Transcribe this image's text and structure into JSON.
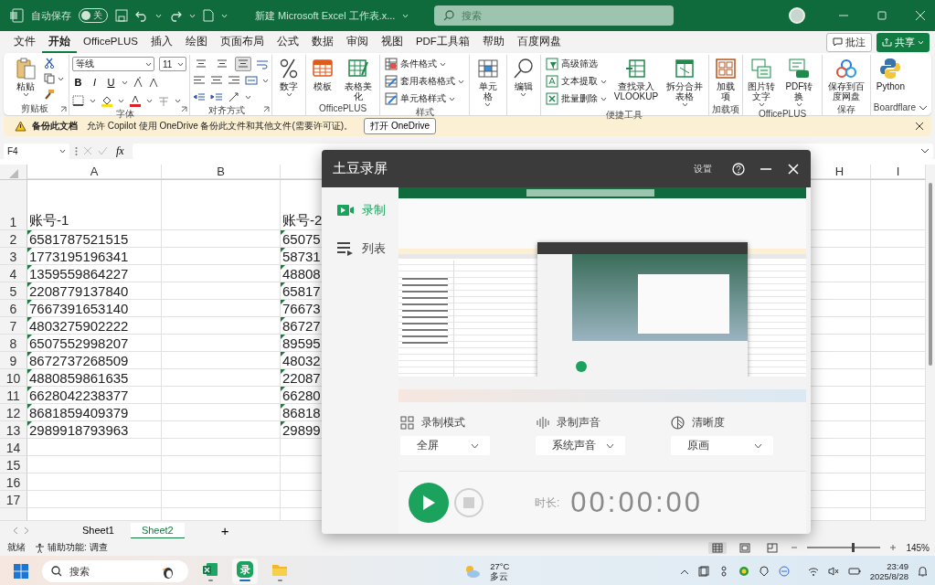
{
  "title_bar": {
    "autosave": {
      "label": "自动保存",
      "on": false,
      "state_text": "关"
    },
    "document_title": "新建 Microsoft Excel 工作表.x...",
    "search": {
      "placeholder": "搜索"
    }
  },
  "menu_tabs": [
    {
      "label": "文件",
      "selected": false
    },
    {
      "label": "开始",
      "selected": true
    },
    {
      "label": "OfficePLUS",
      "selected": false
    },
    {
      "label": "插入",
      "selected": false
    },
    {
      "label": "绘图",
      "selected": false
    },
    {
      "label": "页面布局",
      "selected": false
    },
    {
      "label": "公式",
      "selected": false
    },
    {
      "label": "数据",
      "selected": false
    },
    {
      "label": "审阅",
      "selected": false
    },
    {
      "label": "视图",
      "selected": false
    },
    {
      "label": "PDF工具箱",
      "selected": false
    },
    {
      "label": "帮助",
      "selected": false
    },
    {
      "label": "百度网盘",
      "selected": false
    }
  ],
  "comment_button": "批注",
  "share_button": "共享",
  "ribbon": {
    "groups": [
      {
        "kind": "buttons",
        "label": "剪贴板",
        "launcher": true,
        "items": [
          {
            "kind": "large",
            "label": "粘贴",
            "dropdown": true
          },
          {
            "kind": "small",
            "dropdown": false
          },
          {
            "kind": "small",
            "dropdown": true
          },
          {
            "kind": "small",
            "dropdown": false
          }
        ]
      },
      {
        "kind": "font",
        "label": "字体",
        "launcher": true,
        "font_name": "等线",
        "font_size": "11",
        "styles": [
          "B",
          "I",
          "U"
        ]
      },
      {
        "kind": "align",
        "label": "对齐方式",
        "launcher": true,
        "vertical_align": [
          {
            "selected": false
          },
          {
            "selected": false
          },
          {
            "selected": true
          }
        ]
      },
      {
        "kind": "buttons",
        "launcher": false,
        "items": [
          {
            "kind": "large",
            "label": "数字",
            "dropdown": true
          }
        ]
      },
      {
        "kind": "buttons",
        "label": "OfficePLUS",
        "launcher": false,
        "items": [
          {
            "kind": "large",
            "label": "模板",
            "dropdown": false
          },
          {
            "kind": "large",
            "label": "表格美化",
            "dropdown": false
          }
        ]
      },
      {
        "kind": "buttons",
        "label": "样式",
        "launcher": false,
        "items": [
          {
            "kind": "small",
            "label": "条件格式",
            "dropdown": true
          },
          {
            "kind": "small",
            "label": "套用表格格式",
            "dropdown": true
          },
          {
            "kind": "small",
            "label": "单元格样式",
            "dropdown": true
          }
        ]
      },
      {
        "kind": "buttons",
        "launcher": false,
        "items": [
          {
            "kind": "large",
            "label": "单元格",
            "dropdown": true
          }
        ]
      },
      {
        "kind": "buttons",
        "launcher": false,
        "items": [
          {
            "kind": "large",
            "label": "编辑",
            "dropdown": true
          }
        ]
      },
      {
        "kind": "buttons",
        "label": "便捷工具",
        "launcher": false,
        "items": [
          {
            "kind": "small",
            "label": "高级筛选",
            "dropdown": false
          },
          {
            "kind": "small",
            "label": "文本提取",
            "dropdown": true
          },
          {
            "kind": "small",
            "label": "批量删除",
            "dropdown": true
          },
          {
            "kind": "large",
            "label": "查找录入\nVLOOKUP",
            "dropdown": false
          },
          {
            "kind": "large",
            "label": "拆分合并表格",
            "dropdown": true
          }
        ]
      },
      {
        "kind": "buttons",
        "label": "加载项",
        "launcher": false,
        "items": [
          {
            "kind": "large",
            "label": "加载项",
            "dropdown": false
          }
        ]
      },
      {
        "kind": "buttons",
        "label": "OfficePLUS",
        "launcher": false,
        "items": [
          {
            "kind": "large",
            "label": "图片转文字",
            "dropdown": true
          },
          {
            "kind": "large",
            "label": "PDF转换",
            "dropdown": true
          }
        ]
      },
      {
        "kind": "buttons",
        "label": "保存",
        "launcher": false,
        "items": [
          {
            "kind": "large",
            "label": "保存到百度网盘",
            "dropdown": false
          }
        ]
      },
      {
        "kind": "buttons",
        "label": "Boardflare",
        "launcher": false,
        "items": [
          {
            "kind": "large",
            "label": "Python",
            "dropdown": false
          }
        ]
      }
    ]
  },
  "notice": {
    "title": "备份此文档",
    "message": "允许 Copilot 使用 OneDrive 备份此文件和其他文件(需要许可证)。",
    "button": "打开 OneDrive"
  },
  "formula_bar": {
    "name_box": "F4",
    "function_label": "fx"
  },
  "sheet": {
    "columns": [
      "A",
      "B",
      "H",
      "I"
    ],
    "rows": [
      {
        "number": "1",
        "a": "账号-1",
        "c": "账号-2",
        "flagged": false
      },
      {
        "number": "2",
        "a": "6581787521515",
        "c": "65075",
        "flagged": true
      },
      {
        "number": "3",
        "a": "1773195196341",
        "c": "58731",
        "flagged": true
      },
      {
        "number": "4",
        "a": "1359559864227",
        "c": "48808",
        "flagged": true
      },
      {
        "number": "5",
        "a": "2208779137840",
        "c": "65817",
        "flagged": true
      },
      {
        "number": "6",
        "a": "7667391653140",
        "c": "76673",
        "flagged": true
      },
      {
        "number": "7",
        "a": "4803275902222",
        "c": "86727",
        "flagged": true
      },
      {
        "number": "8",
        "a": "6507552998207",
        "c": "89595",
        "flagged": true
      },
      {
        "number": "9",
        "a": "8672737268509",
        "c": "48032",
        "flagged": true
      },
      {
        "number": "10",
        "a": "4880859861635",
        "c": "22087",
        "flagged": true
      },
      {
        "number": "11",
        "a": "6628042238377",
        "c": "66280",
        "flagged": true
      },
      {
        "number": "12",
        "a": "8681859409379",
        "c": "86818",
        "flagged": true
      },
      {
        "number": "13",
        "a": "2989918793963",
        "c": "29899",
        "flagged": true
      },
      {
        "number": "14",
        "a": "",
        "c": "",
        "flagged": false
      },
      {
        "number": "15",
        "a": "",
        "c": "",
        "flagged": false
      },
      {
        "number": "16",
        "a": "",
        "c": "",
        "flagged": false
      },
      {
        "number": "17",
        "a": "",
        "c": "",
        "flagged": false
      }
    ],
    "tabs": [
      {
        "label": "Sheet1",
        "selected": false
      },
      {
        "label": "Sheet2",
        "selected": true
      }
    ],
    "add_tab": "+"
  },
  "status_bar": {
    "ready": "就绪",
    "accessibility": "辅助功能: 调查",
    "views": [
      {
        "selected": true
      },
      {
        "selected": false
      },
      {
        "selected": false
      }
    ],
    "zoom": {
      "level": 0.62,
      "reading": "145%"
    }
  },
  "recorder": {
    "title": "土豆录屏",
    "settings": "设置",
    "sidebar": [
      {
        "label": "录制",
        "selected": true
      },
      {
        "label": "列表",
        "selected": false
      }
    ],
    "options": [
      {
        "label": "录制模式",
        "value": "全屏"
      },
      {
        "label": "录制声音",
        "value": "系统声音"
      },
      {
        "label": "清晰度",
        "value": "原画"
      }
    ],
    "duration_label": "时长:",
    "duration": "00:00:00"
  },
  "taskbar": {
    "search_placeholder": "搜索",
    "recorder_app": "录",
    "weather": {
      "temperature": "27°C",
      "condition": "多云"
    },
    "time": "23:49",
    "date": "2025/8/28"
  }
}
